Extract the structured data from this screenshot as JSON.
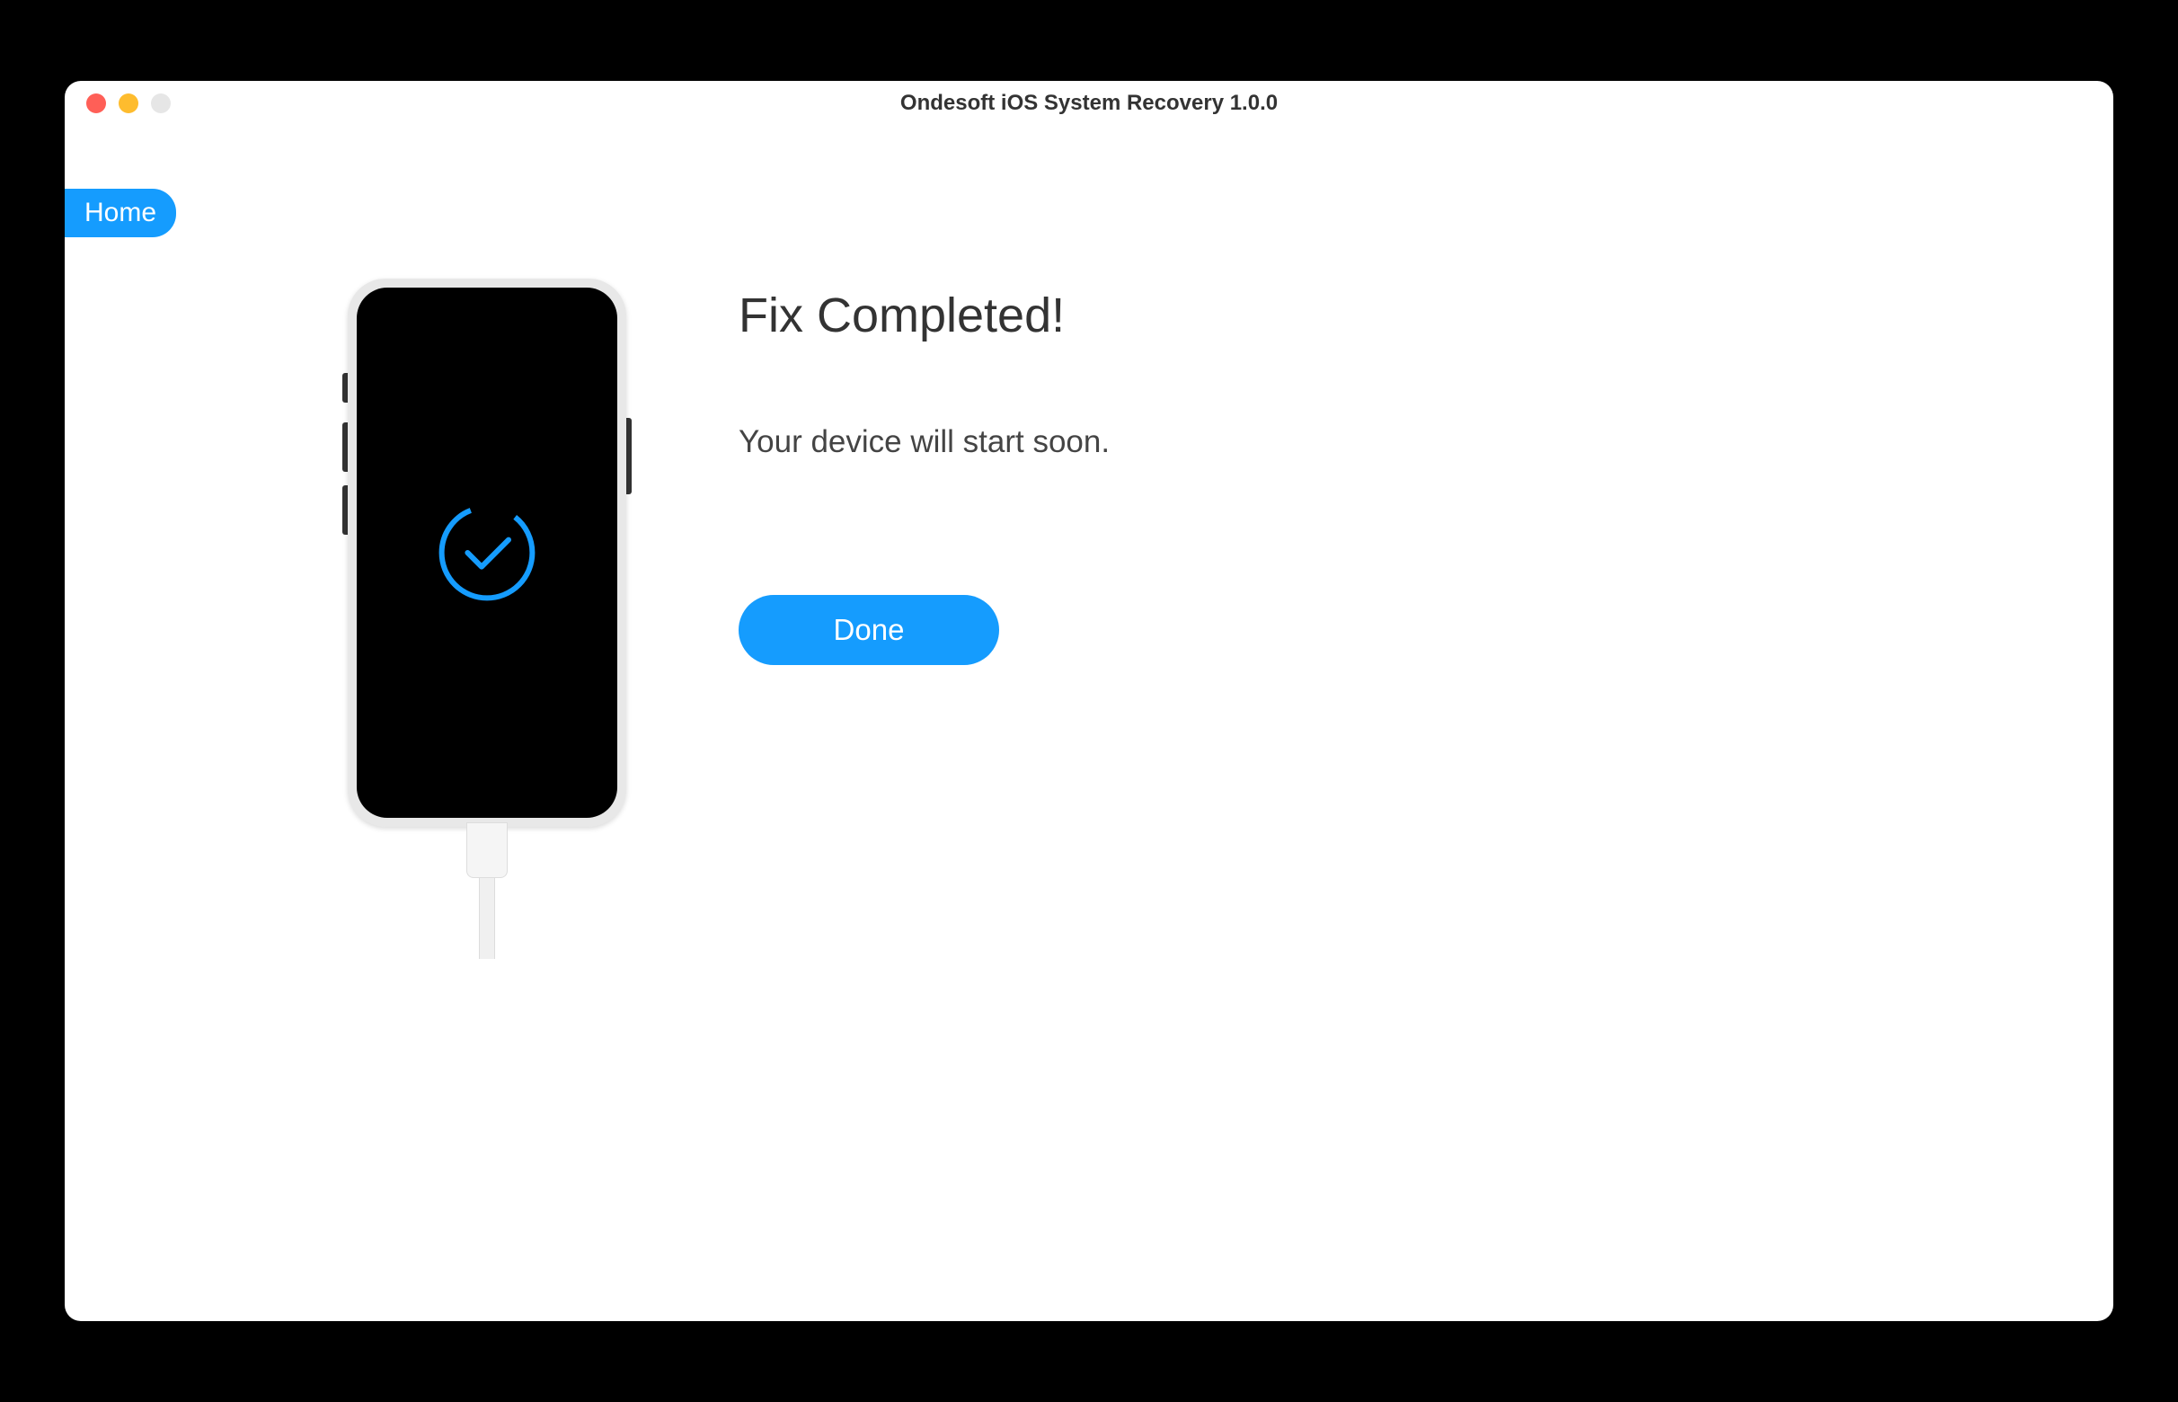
{
  "window": {
    "title": "Ondesoft iOS System Recovery 1.0.0"
  },
  "nav": {
    "home_label": "Home"
  },
  "status": {
    "title": "Fix Completed!",
    "subtitle": "Your device will start soon.",
    "done_label": "Done"
  },
  "colors": {
    "accent": "#159cfe"
  }
}
